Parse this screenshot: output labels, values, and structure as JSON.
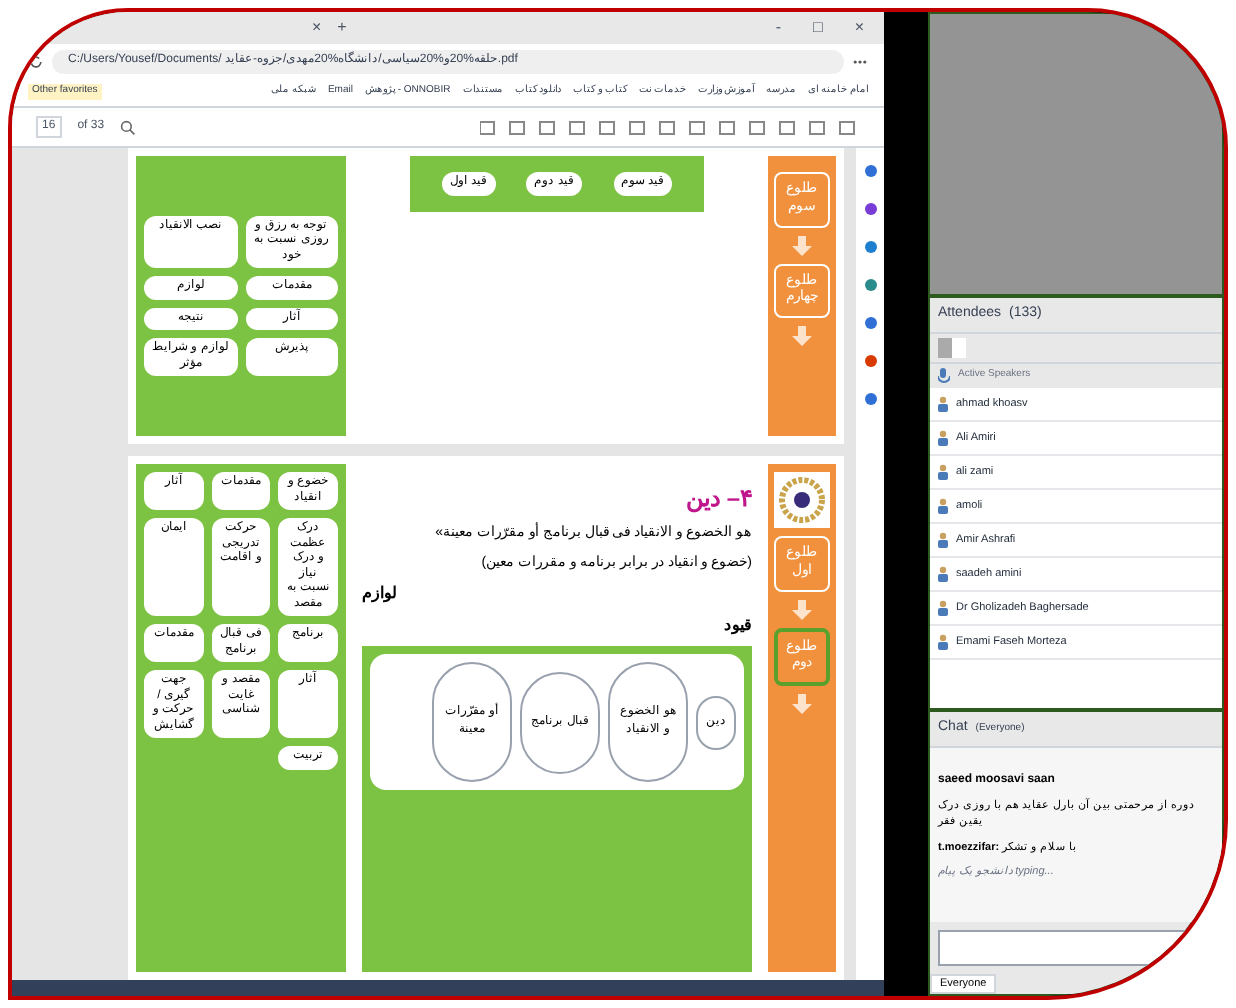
{
  "browser": {
    "tab_close": "×",
    "new_tab": "+",
    "minimize": "-",
    "maximize": "□",
    "close": "×",
    "address": "C:/Users/Yousef/Documents/ حلقه%20و%20سیاسی/دانشگاه%20مهدی/جزوه-عقاید.pdf",
    "bookmarks": [
      "امام خامنه ای",
      "مدرسه",
      "آموزش وزارت",
      "خدمات نت",
      "کتاب و کتاب",
      "دانلود کتاب",
      "مستندات",
      "ONNOBIR - پژوهش",
      "Email",
      "شبکه ملی"
    ],
    "other_favorites": "Other favorites",
    "pdf_toolbar": {
      "page": "16",
      "total": "of 33"
    }
  },
  "page_top": {
    "left_boxes": [
      "توجه به رزق و روزی نسبت به خود",
      "نصب الانقیاد",
      "مقدمات",
      "لوازم",
      "آثار",
      "نتیجه",
      "پذیرش",
      "لوازم و شرایط مؤثر"
    ],
    "constraints": [
      "قید سوم",
      "قید دوم",
      "قید اول"
    ],
    "steps": [
      {
        "label": "طلوع سوم",
        "selected": false
      },
      {
        "label": "طلوع چهارم",
        "selected": false
      }
    ]
  },
  "page_bottom": {
    "heading": "۴– دین",
    "definition": "هو الخضوع و الانقیاد فی قبال برنامج أو مقرّرات معینة»",
    "translation": "(خضوع و انقیاد در برابر برنامه و مقررات معین)",
    "subheads": [
      "لوازم",
      "قیود"
    ],
    "diagram": {
      "term": "دین",
      "parts": [
        "هو الخضوع و الانقیاد",
        "قبال برنامج",
        "أو مقرّرات معینة"
      ]
    },
    "left_boxes": [
      "خضوع و انقیاد",
      "مقدمات",
      "آثار",
      "درک عظمت و درک نیاز نسبت به مقصد",
      "حرکت تدریجی و اقامت",
      "ایمان",
      "برنامج",
      "فی قبال برنامج",
      "مقدمات",
      "آثار",
      "مقصد و غایت شناسی",
      "جهت گیری / حرکت و گشایش",
      "تربیت"
    ],
    "steps": [
      {
        "label": "طلوع اول",
        "selected": false
      },
      {
        "label": "طلوع دوم",
        "selected": true
      }
    ]
  },
  "attendees": {
    "title": "Attendees",
    "count": "(133)",
    "active_speakers": "Active Speakers",
    "people": [
      "ahmad khoasv",
      "Ali Amiri",
      "ali zami",
      "amoli",
      "Amir Ashrafi",
      "saadeh amini",
      "Dr Gholizadeh Baghersade",
      "Emami Faseh Morteza"
    ]
  },
  "chat": {
    "title": "Chat",
    "scope": "(Everyone)",
    "messages": [
      {
        "kind": "name",
        "text": "saeed moosavi saan"
      },
      {
        "kind": "text",
        "text": "دوره از مرحمتی بین آن بارل عقاید هم با روزی درک یقین فقر"
      },
      {
        "kind": "line",
        "name": "t.moezzifar:",
        "text": " با سلام و تشکر"
      },
      {
        "kind": "typing",
        "text": "دانشجو یک پیام typing..."
      }
    ],
    "recipient": "Everyone"
  }
}
